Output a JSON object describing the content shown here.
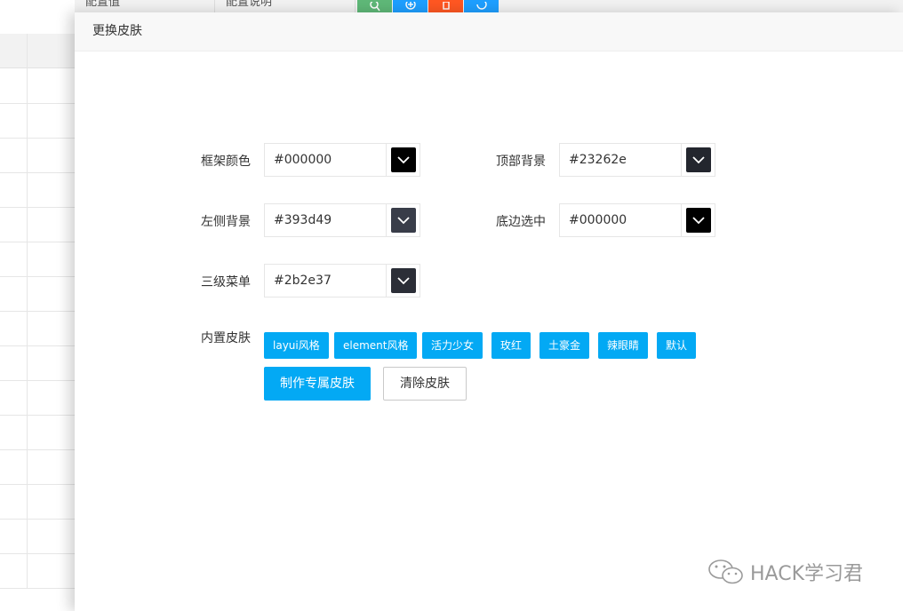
{
  "background": {
    "fields": [
      "配置值",
      "配置说明"
    ],
    "toolbar_icons": [
      {
        "icon": "search-icon",
        "color": "#5fb878"
      },
      {
        "icon": "add-icon",
        "color": "#1e9fff"
      },
      {
        "icon": "delete-icon",
        "color": "#ff5722"
      },
      {
        "icon": "refresh-icon",
        "color": "#1e9fff"
      }
    ]
  },
  "dialog": {
    "title": "更换皮肤",
    "fields": {
      "frame_color": {
        "label": "框架颜色",
        "value": "#000000",
        "swatch": "#000000"
      },
      "top_bg": {
        "label": "顶部背景",
        "value": "#23262e",
        "swatch": "#23262e"
      },
      "left_bg": {
        "label": "左侧背景",
        "value": "#393d49",
        "swatch": "#393d49"
      },
      "bottom_selected": {
        "label": "底边选中",
        "value": "#000000",
        "swatch": "#000000"
      },
      "third_menu": {
        "label": "三级菜单",
        "value": "#2b2e37",
        "swatch": "#2b2e37"
      }
    },
    "builtin_label": "内置皮肤",
    "builtin_skins": [
      "layui风格",
      "element风格",
      "活力少女",
      "玫红",
      "土豪金",
      "辣眼睛",
      "默认"
    ],
    "actions": {
      "make_custom": "制作专属皮肤",
      "clear": "清除皮肤"
    }
  },
  "watermark": "HACK学习君",
  "colors": {
    "accent": "#03a9f4"
  }
}
